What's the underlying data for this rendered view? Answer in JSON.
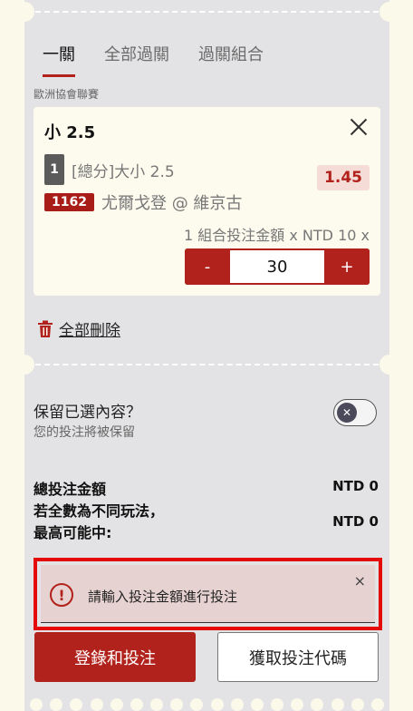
{
  "tabs": [
    {
      "label": "一關"
    },
    {
      "label": "全部過關"
    },
    {
      "label": "過關組合"
    }
  ],
  "league": "歐洲協會聯賽",
  "bet": {
    "selection": "小 2.5",
    "leg_number": "1",
    "market": "[總分]大小 2.5",
    "odds": "1.45",
    "match_id": "1162",
    "teams": "尤爾戈登 @ 維京古",
    "stake_info": "1 組合投注金額 x NTD 10 x",
    "stake_value": "30",
    "minus_label": "-",
    "plus_label": "+"
  },
  "delete_all": "全部刪除",
  "keep": {
    "title": "保留已選內容？",
    "subtitle": "您的投注將被保留",
    "toggle_on": false
  },
  "summary": {
    "total_label": "總投注金額",
    "total_value": "NTD 0",
    "max_label_1": "若全數為不同玩法，",
    "max_label_2": "最高可能中:",
    "max_value": "NTD 0"
  },
  "alert": {
    "message": "請輸入投注金額進行投注",
    "close": "×"
  },
  "buttons": {
    "login_bet": "登錄和投注",
    "get_code": "獲取投注代碼"
  },
  "colors": {
    "accent": "#b2221c",
    "panel": "#e3e3e5",
    "background": "#fbf9ea",
    "alert_border": "#e40a0a"
  }
}
